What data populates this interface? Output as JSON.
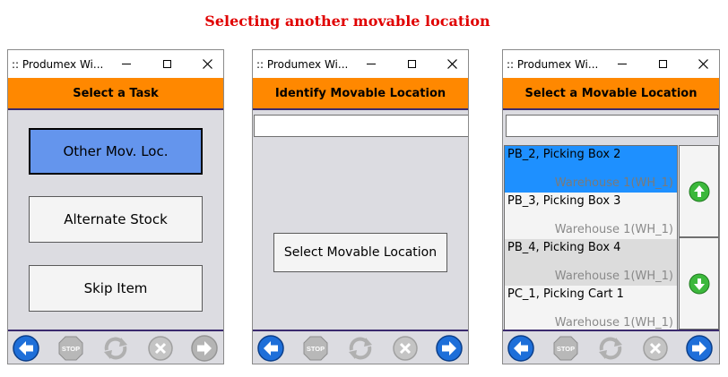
{
  "page_title": "Selecting another movable location",
  "windows": [
    {
      "app_title": ":: Produmex Wi...",
      "header": "Select a Task",
      "buttons": [
        {
          "label": "Other Mov. Loc.",
          "selected": true
        },
        {
          "label": "Alternate Stock",
          "selected": false
        },
        {
          "label": "Skip Item",
          "selected": false
        }
      ]
    },
    {
      "app_title": ":: Produmex Wi...",
      "header": "Identify Movable Location",
      "input_value": "",
      "select_button": "Select Movable Location"
    },
    {
      "app_title": ":: Produmex Wi...",
      "header": "Select a Movable Location",
      "input_value": "",
      "items": [
        {
          "name": "PB_2, Picking Box 2",
          "warehouse": "Warehouse 1(WH_1)",
          "selected": true
        },
        {
          "name": "PB_3, Picking Box 3",
          "warehouse": "Warehouse 1(WH_1)",
          "selected": false
        },
        {
          "name": "PB_4, Picking Box 4",
          "warehouse": "Warehouse 1(WH_1)",
          "selected": false
        },
        {
          "name": "PC_1, Picking Cart 1",
          "warehouse": "Warehouse 1(WH_1)",
          "selected": false
        }
      ]
    }
  ],
  "toolbar_icons": [
    "back-arrow-icon",
    "stop-icon",
    "refresh-icon",
    "cancel-icon",
    "forward-arrow-icon"
  ],
  "colors": {
    "header_orange": "#ff8800",
    "selected_blue": "#1e90ff",
    "active_button": "#6495ed",
    "title_red": "#e00000",
    "nav_blue": "#1e6fd9",
    "scroll_green": "#3cb83c"
  }
}
